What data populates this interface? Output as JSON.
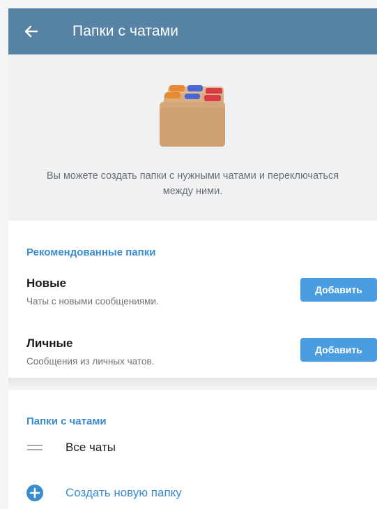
{
  "header": {
    "title": "Папки с чатами",
    "back_icon": "arrow-left-icon"
  },
  "hero": {
    "description": "Вы можете создать папки с нужными чатами и переключаться между ними."
  },
  "recommended": {
    "title": "Рекомендованные папки",
    "items": [
      {
        "name": "Новые",
        "description": "Чаты с новыми сообщениями.",
        "button": "Добавить"
      },
      {
        "name": "Личные",
        "description": "Сообщения из личных чатов.",
        "button": "Добавить"
      }
    ]
  },
  "folders": {
    "title": "Папки с чатами",
    "items": [
      {
        "label": "Все чаты",
        "icon": "drag-handle-icon"
      }
    ],
    "create": {
      "label": "Создать новую папку",
      "icon": "plus-circle-icon"
    }
  },
  "colors": {
    "appbar": "#5682a3",
    "accent": "#3a8ccf",
    "button": "#4a9de0"
  }
}
